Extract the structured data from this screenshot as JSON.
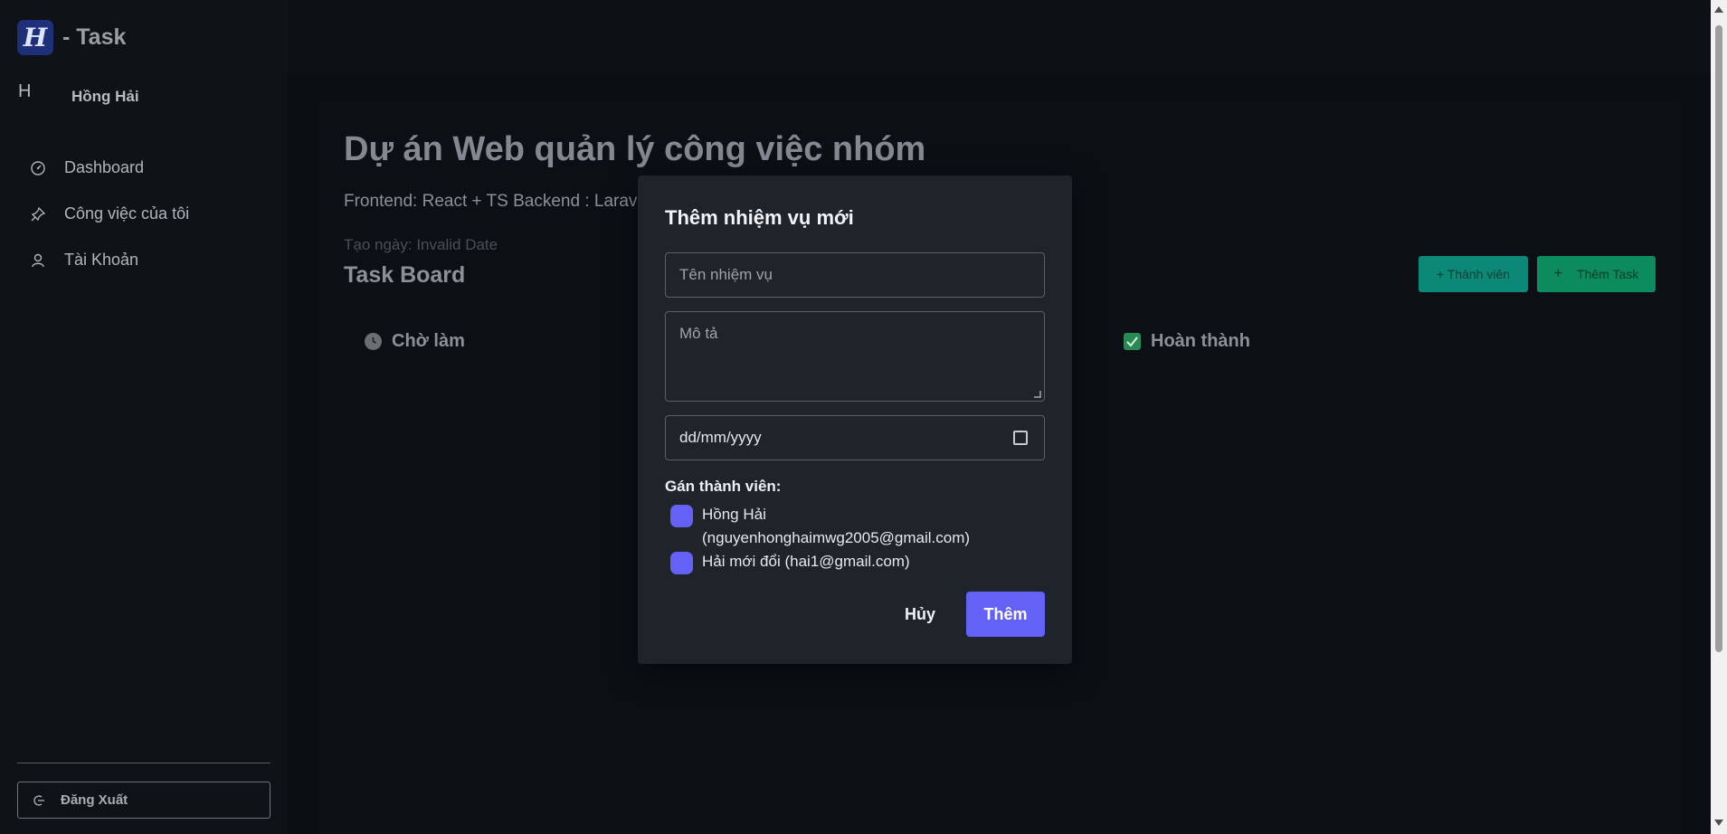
{
  "app": {
    "logo_letter": "H",
    "title": "- Task"
  },
  "user": {
    "initial": "H",
    "name": "Hồng Hải"
  },
  "sidebar": {
    "items": [
      {
        "label": "Dashboard",
        "icon": "dashboard-gauge-icon"
      },
      {
        "label": "Công việc của tôi",
        "icon": "pin-icon"
      },
      {
        "label": "Tài Khoản",
        "icon": "user-icon"
      }
    ],
    "logout_label": "Đăng Xuất",
    "logout_icon": "logout-icon"
  },
  "project": {
    "title": "Dự án Web quản lý công việc nhóm",
    "description": "Frontend: React + TS Backend : Larav",
    "created": "Tạo ngày: Invalid Date",
    "board_title": "Task Board",
    "add_member_label": "+ Thành viên",
    "add_task_label": "Thêm Task",
    "columns": [
      {
        "label": "Chờ làm",
        "icon": "clock-icon"
      },
      {
        "label": "Hoàn thành",
        "icon": "checkbox-icon"
      }
    ]
  },
  "modal": {
    "title": "Thêm nhiệm vụ mới",
    "name_placeholder": "Tên nhiệm vụ",
    "desc_placeholder": "Mô tả",
    "date_placeholder": "dd/mm/yyyy",
    "assign_label": "Gán thành viên:",
    "members": [
      {
        "line1": "Hồng Hải",
        "line2": "(nguyenhonghaimwg2005@gmail.com)"
      },
      {
        "line1": "Hải mới đổi (hai1@gmail.com)",
        "line2": ""
      }
    ],
    "cancel_label": "Hủy",
    "submit_label": "Thêm"
  },
  "colors": {
    "accent": "#6461f7",
    "member_button": "#0b8876",
    "task_button": "#0c8b5e",
    "background": "#0c0f13"
  }
}
